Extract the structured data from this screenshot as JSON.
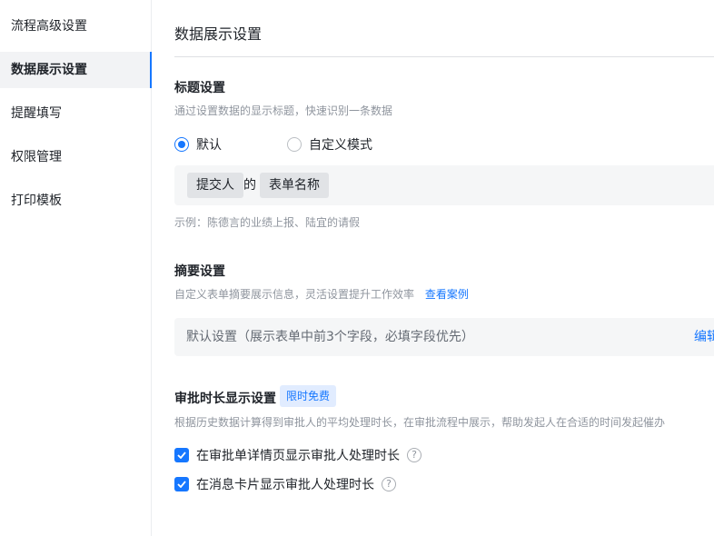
{
  "sidebar": {
    "items": [
      {
        "label": "流程高级设置"
      },
      {
        "label": "数据展示设置"
      },
      {
        "label": "提醒填写"
      },
      {
        "label": "权限管理"
      },
      {
        "label": "打印模板"
      }
    ]
  },
  "page": {
    "title": "数据展示设置"
  },
  "title_settings": {
    "heading": "标题设置",
    "description": "通过设置数据的显示标题，快速识别一条数据",
    "options": [
      {
        "label": "默认",
        "checked": true
      },
      {
        "label": "自定义模式",
        "checked": false
      }
    ],
    "chips": [
      "提交人",
      "表单名称"
    ],
    "connector": "的",
    "example": "示例：陈德言的业绩上报、陆宜的请假"
  },
  "summary_settings": {
    "heading": "摘要设置",
    "description": "自定义表单摘要展示信息，灵活设置提升工作效率",
    "link": "查看案例",
    "box_text": "默认设置（展示表单中前3个字段，必填字段优先）",
    "edit": "编辑"
  },
  "approval_duration": {
    "heading": "审批时长显示设置",
    "badge": "限时免费",
    "description": "根据历史数据计算得到审批人的平均处理时长，在审批流程中展示，帮助发起人在合适的时间发起催办",
    "checks": [
      {
        "label": "在审批单详情页显示审批人处理时长",
        "checked": true
      },
      {
        "label": "在消息卡片显示审批人处理时长",
        "checked": true
      }
    ],
    "help_glyph": "?"
  },
  "colors": {
    "accent": "#1677ff",
    "muted": "#8f959e",
    "panel": "#f5f6f7"
  }
}
